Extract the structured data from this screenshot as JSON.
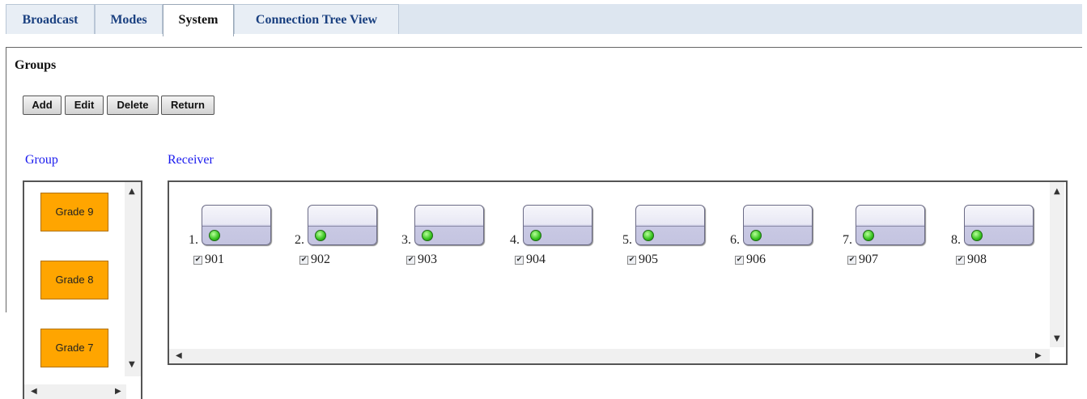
{
  "tabs": [
    {
      "label": "Broadcast",
      "active": false
    },
    {
      "label": "Modes",
      "active": false
    },
    {
      "label": "System",
      "active": true
    },
    {
      "label": "Connection Tree View",
      "active": false
    }
  ],
  "page": {
    "title": "Groups",
    "buttons": {
      "add": "Add",
      "edit": "Edit",
      "delete": "Delete",
      "return": "Return"
    }
  },
  "group_panel": {
    "label": "Group",
    "items": [
      "Grade 9",
      "Grade 8",
      "Grade 7"
    ]
  },
  "receiver_panel": {
    "label": "Receiver",
    "receivers": [
      {
        "index": "1.",
        "id": "901",
        "checked": true
      },
      {
        "index": "2.",
        "id": "902",
        "checked": true
      },
      {
        "index": "3.",
        "id": "903",
        "checked": true
      },
      {
        "index": "4.",
        "id": "904",
        "checked": true
      },
      {
        "index": "5.",
        "id": "905",
        "checked": true
      },
      {
        "index": "6.",
        "id": "906",
        "checked": true
      },
      {
        "index": "7.",
        "id": "907",
        "checked": true
      },
      {
        "index": "8.",
        "id": "908",
        "checked": true
      }
    ]
  },
  "icons": {
    "check": "✔",
    "arrow_up": "▲",
    "arrow_down": "▼",
    "arrow_left": "◀",
    "arrow_right": "▶"
  },
  "colors": {
    "group_button": "#ffa500",
    "label_blue": "#1a1aee",
    "tab_text": "#1a4080",
    "status_led": "#35c21e"
  }
}
